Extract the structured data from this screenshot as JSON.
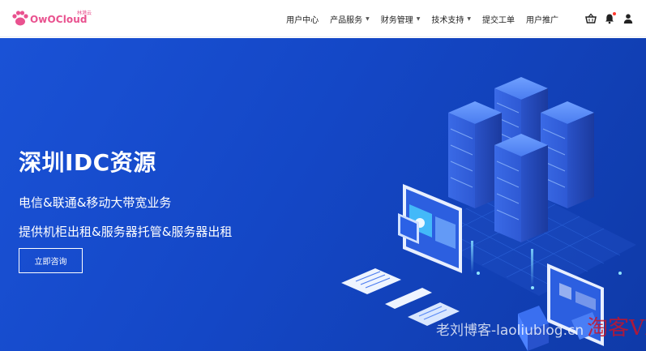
{
  "brand": {
    "name": "OwOCloud",
    "sub": "林港云",
    "color": "#e9528f"
  },
  "nav": {
    "items": [
      {
        "label": "用户中心",
        "dropdown": false
      },
      {
        "label": "产品服务",
        "dropdown": true
      },
      {
        "label": "财务管理",
        "dropdown": true
      },
      {
        "label": "技术支持",
        "dropdown": true
      },
      {
        "label": "提交工单",
        "dropdown": false
      },
      {
        "label": "用户推广",
        "dropdown": false
      }
    ],
    "caret": "▼"
  },
  "header_icons": [
    "basket-icon",
    "bell-icon",
    "user-icon"
  ],
  "hero": {
    "title": "深圳IDC资源",
    "line1": "电信&联通&移动大带宽业务",
    "line2": "提供机柜出租&服务器托管&服务器出租",
    "button": "立即咨询",
    "background": "#1447c6"
  },
  "watermark": {
    "text": "老刘博客-laoliublog.cn",
    "overlay": "淘客VPS"
  }
}
